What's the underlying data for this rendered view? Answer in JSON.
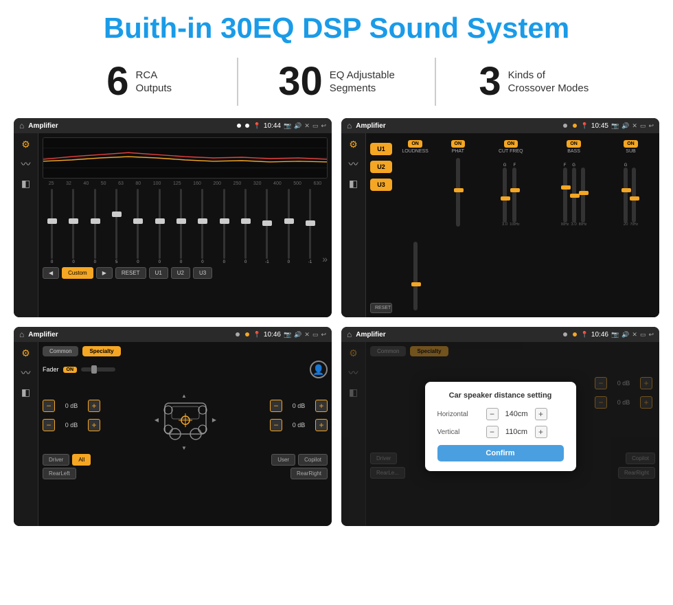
{
  "header": {
    "title": "Buith-in 30EQ DSP Sound System"
  },
  "stats": [
    {
      "number": "6",
      "label": "RCA\nOutputs"
    },
    {
      "number": "30",
      "label": "EQ Adjustable\nSegments"
    },
    {
      "number": "3",
      "label": "Kinds of\nCrossover Modes"
    }
  ],
  "screens": [
    {
      "id": "eq-screen",
      "statusbar": {
        "app": "Amplifier",
        "time": "10:44"
      },
      "type": "eq"
    },
    {
      "id": "amp-screen",
      "statusbar": {
        "app": "Amplifier",
        "time": "10:45"
      },
      "type": "amp"
    },
    {
      "id": "fader-screen",
      "statusbar": {
        "app": "Amplifier",
        "time": "10:46"
      },
      "type": "fader"
    },
    {
      "id": "dialog-screen",
      "statusbar": {
        "app": "Amplifier",
        "time": "10:46"
      },
      "type": "dialog"
    }
  ],
  "eq": {
    "freqs": [
      "25",
      "32",
      "40",
      "50",
      "63",
      "80",
      "100",
      "125",
      "160",
      "200",
      "250",
      "320",
      "400",
      "500",
      "630"
    ],
    "values": [
      "0",
      "0",
      "0",
      "5",
      "0",
      "0",
      "0",
      "0",
      "0",
      "0",
      "-1",
      "0",
      "-1"
    ],
    "preset": "Custom",
    "buttons": [
      "◀",
      "Custom",
      "▶",
      "RESET",
      "U1",
      "U2",
      "U3"
    ]
  },
  "amp": {
    "presets": [
      "U1",
      "U2",
      "U3"
    ],
    "controls": [
      {
        "label": "LOUDNESS",
        "on": true
      },
      {
        "label": "PHAT",
        "on": true
      },
      {
        "label": "CUT FREQ",
        "on": true
      },
      {
        "label": "BASS",
        "on": true
      },
      {
        "label": "SUB",
        "on": true
      }
    ],
    "reset": "RESET"
  },
  "fader": {
    "tabs": [
      "Common",
      "Specialty"
    ],
    "active_tab": "Specialty",
    "fader_label": "Fader",
    "on_label": "ON",
    "vol_items": [
      {
        "side": "left_top",
        "val": "0 dB"
      },
      {
        "side": "left_bot",
        "val": "0 dB"
      },
      {
        "side": "right_top",
        "val": "0 dB"
      },
      {
        "side": "right_bot",
        "val": "0 dB"
      }
    ],
    "buttons": [
      "Driver",
      "RearLeft",
      "All",
      "User",
      "RearRight",
      "Copilot"
    ]
  },
  "dialog": {
    "title": "Car speaker distance setting",
    "horizontal_label": "Horizontal",
    "horizontal_value": "140cm",
    "vertical_label": "Vertical",
    "vertical_value": "110cm",
    "confirm_label": "Confirm",
    "right_vol_1": "0 dB",
    "right_vol_2": "0 dB"
  },
  "colors": {
    "accent": "#f5a623",
    "blue": "#1a9be8",
    "bg_dark": "#111111",
    "bg_card": "#1a1a1a"
  }
}
